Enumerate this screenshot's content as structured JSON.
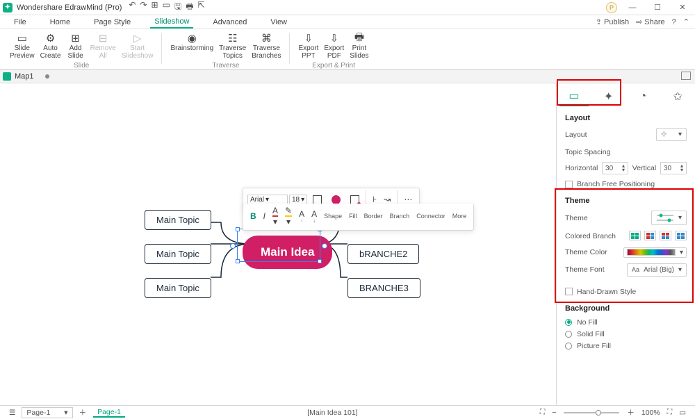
{
  "title_bar": {
    "app_name": "Wondershare EdrawMind (Pro)",
    "avatar_letter": "P"
  },
  "menu": {
    "items": [
      "File",
      "Home",
      "Page Style",
      "Slideshow",
      "Advanced",
      "View"
    ],
    "active_index": 3,
    "publish": "Publish",
    "share": "Share"
  },
  "ribbon": {
    "group1": {
      "label": "Slide",
      "buttons": [
        {
          "label": "Slide\nPreview"
        },
        {
          "label": "Auto\nCreate"
        },
        {
          "label": "Add\nSlide"
        },
        {
          "label": "Remove\nAll"
        },
        {
          "label": "Start\nSlideshow"
        }
      ]
    },
    "group2": {
      "label": "Traverse",
      "buttons": [
        {
          "label": "Brainstorming"
        },
        {
          "label": "Traverse\nTopics"
        },
        {
          "label": "Traverse\nBranches"
        }
      ]
    },
    "group3": {
      "label": "Export & Print",
      "buttons": [
        {
          "label": "Export\nPPT"
        },
        {
          "label": "Export\nPDF"
        },
        {
          "label": "Print\nSlides"
        }
      ]
    }
  },
  "tab": {
    "name": "Map1"
  },
  "canvas": {
    "main_idea": "Main Idea",
    "left_topics": [
      "Main Topic",
      "Main Topic",
      "Main Topic"
    ],
    "right_topics": [
      "bRANCHE2",
      "BRANCHE3"
    ],
    "hidden_top_right": ""
  },
  "float_toolbar": {
    "font": "Arial",
    "size": "18",
    "bold": "B",
    "italic": "I",
    "shape": "Shape",
    "fill": "Fill",
    "border": "Border",
    "branch": "Branch",
    "connector": "Connector",
    "more": "More"
  },
  "panel": {
    "layout_title": "Layout",
    "layout_label": "Layout",
    "topic_spacing": "Topic Spacing",
    "horizontal": "Horizontal",
    "horizontal_val": "30",
    "vertical": "Vertical",
    "vertical_val": "30",
    "branch_free": "Branch Free Positioning",
    "theme_title": "Theme",
    "theme_label": "Theme",
    "colored_branch": "Colored Branch",
    "theme_color": "Theme Color",
    "theme_font": "Theme Font",
    "theme_font_val": "Arial (Big)",
    "hand_drawn": "Hand-Drawn Style",
    "background_title": "Background",
    "no_fill": "No Fill",
    "solid_fill": "Solid Fill",
    "picture_fill": "Picture Fill"
  },
  "status": {
    "page_selector": "Page-1",
    "page_tab": "Page-1",
    "selection_info": "[Main Idea 101]",
    "zoom": "100%"
  }
}
